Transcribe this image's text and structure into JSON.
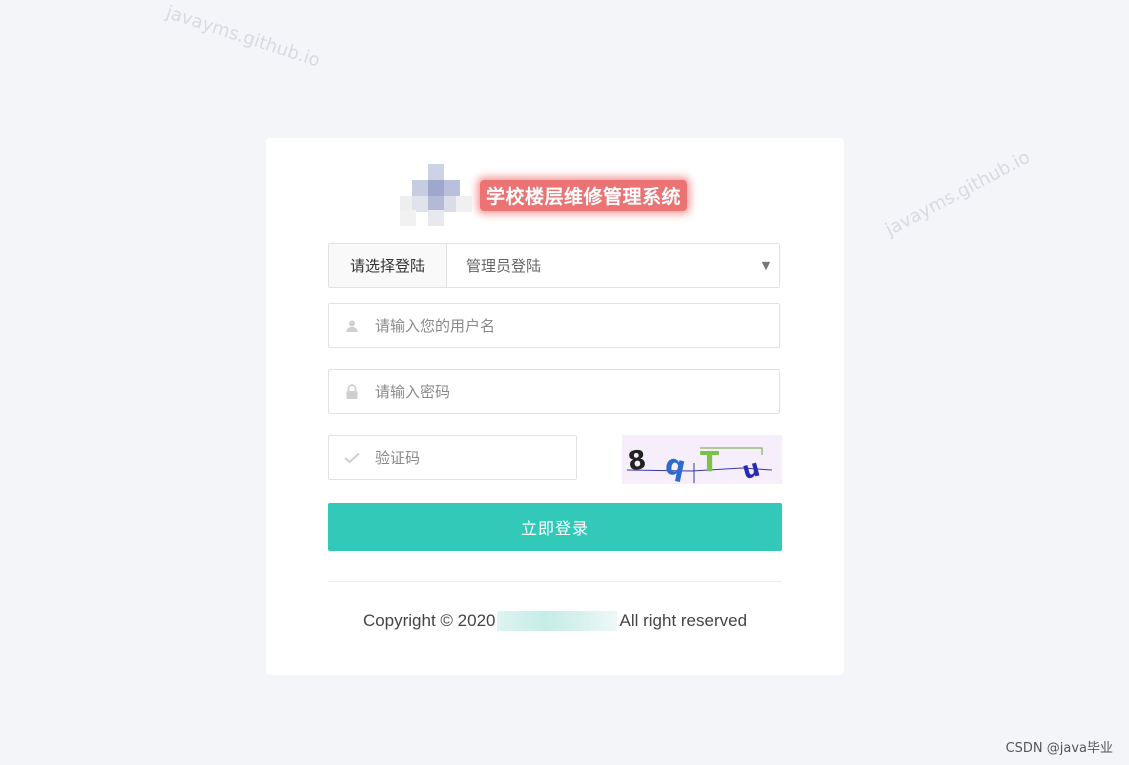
{
  "watermark": "javayms.github.io",
  "header": {
    "title": "学校楼层维修管理系统"
  },
  "login_type": {
    "label": "请选择登陆",
    "selected": "管理员登陆"
  },
  "username": {
    "placeholder": "请输入您的用户名"
  },
  "password": {
    "placeholder": "请输入密码"
  },
  "captcha": {
    "placeholder": "验证码",
    "image_text": "8qTu"
  },
  "login_button": {
    "label": "立即登录"
  },
  "copyright": {
    "prefix": "Copyright © 2020",
    "suffix": "All right reserved"
  },
  "footer_mark": "CSDN @java毕业",
  "icons": {
    "username": "user-icon",
    "password": "lock-icon",
    "captcha": "check-icon",
    "select": "chevron-down-icon"
  },
  "colors": {
    "accent": "#32c9b9",
    "title_highlight": "#e86060",
    "background": "#f4f5f8"
  }
}
